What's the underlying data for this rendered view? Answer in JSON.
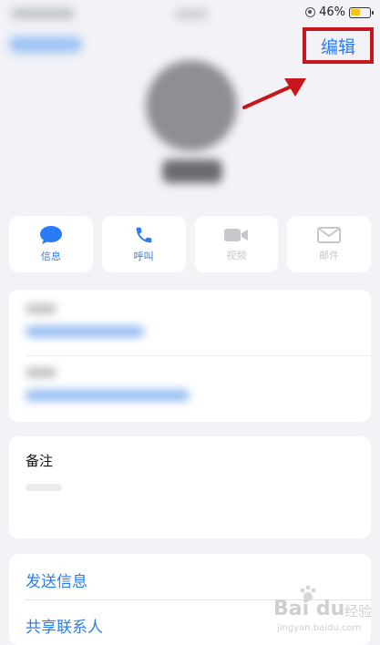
{
  "status_bar": {
    "battery_percent": "46%",
    "battery_level": 0.46,
    "battery_color": "#f5c518"
  },
  "nav": {
    "edit_label": "编辑",
    "highlight_color": "#c8171c"
  },
  "actions": [
    {
      "label": "信息",
      "icon": "message-bubble-icon",
      "enabled": true
    },
    {
      "label": "呼叫",
      "icon": "phone-icon",
      "enabled": true
    },
    {
      "label": "视频",
      "icon": "video-camera-icon",
      "enabled": false
    },
    {
      "label": "邮件",
      "icon": "mail-icon",
      "enabled": false
    }
  ],
  "notes": {
    "label": "备注"
  },
  "links": [
    {
      "label": "发送信息"
    },
    {
      "label": "共享联系人"
    }
  ],
  "watermark": {
    "brand": "Bai du",
    "sub": "经验",
    "url": "jingyan.baidu.com"
  },
  "colors": {
    "accent": "#2a7cf6",
    "background": "#f2f2f7"
  }
}
